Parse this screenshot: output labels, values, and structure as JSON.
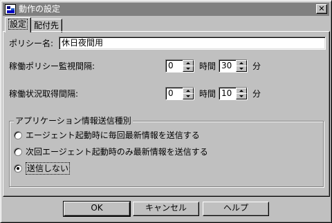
{
  "window": {
    "title": "動作の設定",
    "close_glyph": "✕"
  },
  "tabs": [
    {
      "label": "設定",
      "active": true
    },
    {
      "label": "配付先",
      "active": false
    }
  ],
  "policy": {
    "label": "ポリシー名:",
    "value": "休日夜間用"
  },
  "monitor_interval": {
    "label": "稼働ポリシー監視間隔:",
    "hours": "0",
    "hours_unit": "時間",
    "minutes": "30",
    "minutes_unit": "分"
  },
  "status_interval": {
    "label": "稼働状況取得間隔:",
    "hours": "0",
    "hours_unit": "時間",
    "minutes": "10",
    "minutes_unit": "分"
  },
  "app_info": {
    "title": "アプリケーション情報送信種別",
    "options": [
      {
        "label": "エージェント起動時に毎回最新情報を送信する",
        "selected": false
      },
      {
        "label": "次回エージェント起動時のみ最新情報を送信する",
        "selected": false
      },
      {
        "label": "送信しない",
        "selected": true
      }
    ]
  },
  "buttons": {
    "ok": "OK",
    "cancel": "キャンセル",
    "help": "ヘルプ"
  },
  "colors": {
    "face": "#c0c0c0",
    "title_inactive": "#808080",
    "field": "#ffffff"
  }
}
